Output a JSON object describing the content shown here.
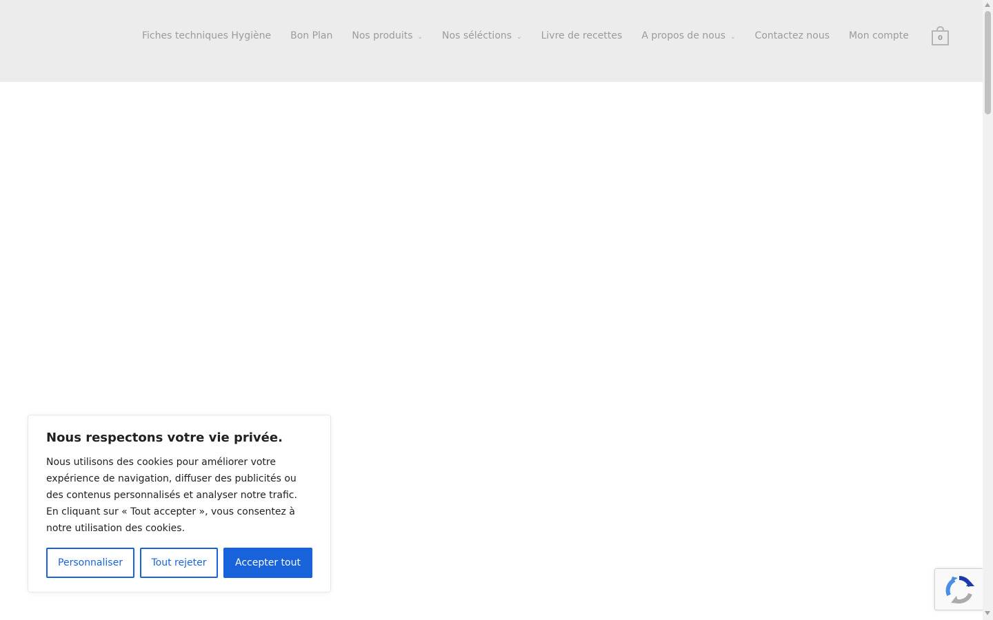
{
  "header": {
    "nav": [
      {
        "label": "Fiches techniques Hygiène",
        "dropdown": false
      },
      {
        "label": "Bon Plan",
        "dropdown": false
      },
      {
        "label": "Nos produits",
        "dropdown": true
      },
      {
        "label": "Nos séléctions",
        "dropdown": true
      },
      {
        "label": "Livre de recettes",
        "dropdown": false
      },
      {
        "label": "A propos de nous",
        "dropdown": true
      },
      {
        "label": "Contactez nous",
        "dropdown": false
      },
      {
        "label": "Mon compte",
        "dropdown": false
      }
    ],
    "cart_count": "0",
    "dropdown_glyph": "⌄"
  },
  "cookie_banner": {
    "title": "Nous respectons votre vie privée.",
    "body": "Nous utilisons des cookies pour améliorer votre expérience de navigation, diffuser des publicités ou des contenus personnalisés et analyser notre trafic. En cliquant sur « Tout accepter », vous consentez à notre utilisation des cookies.",
    "customize_label": "Personnaliser",
    "reject_label": "Tout rejeter",
    "accept_label": "Accepter tout"
  },
  "colors": {
    "header_bg": "#ececec",
    "nav_text": "#9b9b9b",
    "accent": "#1863dc",
    "text": "#212121"
  },
  "icons": {
    "cart": "shopping-bag-icon",
    "recaptcha": "recaptcha-icon",
    "dropdown": "chevron-down-icon"
  }
}
